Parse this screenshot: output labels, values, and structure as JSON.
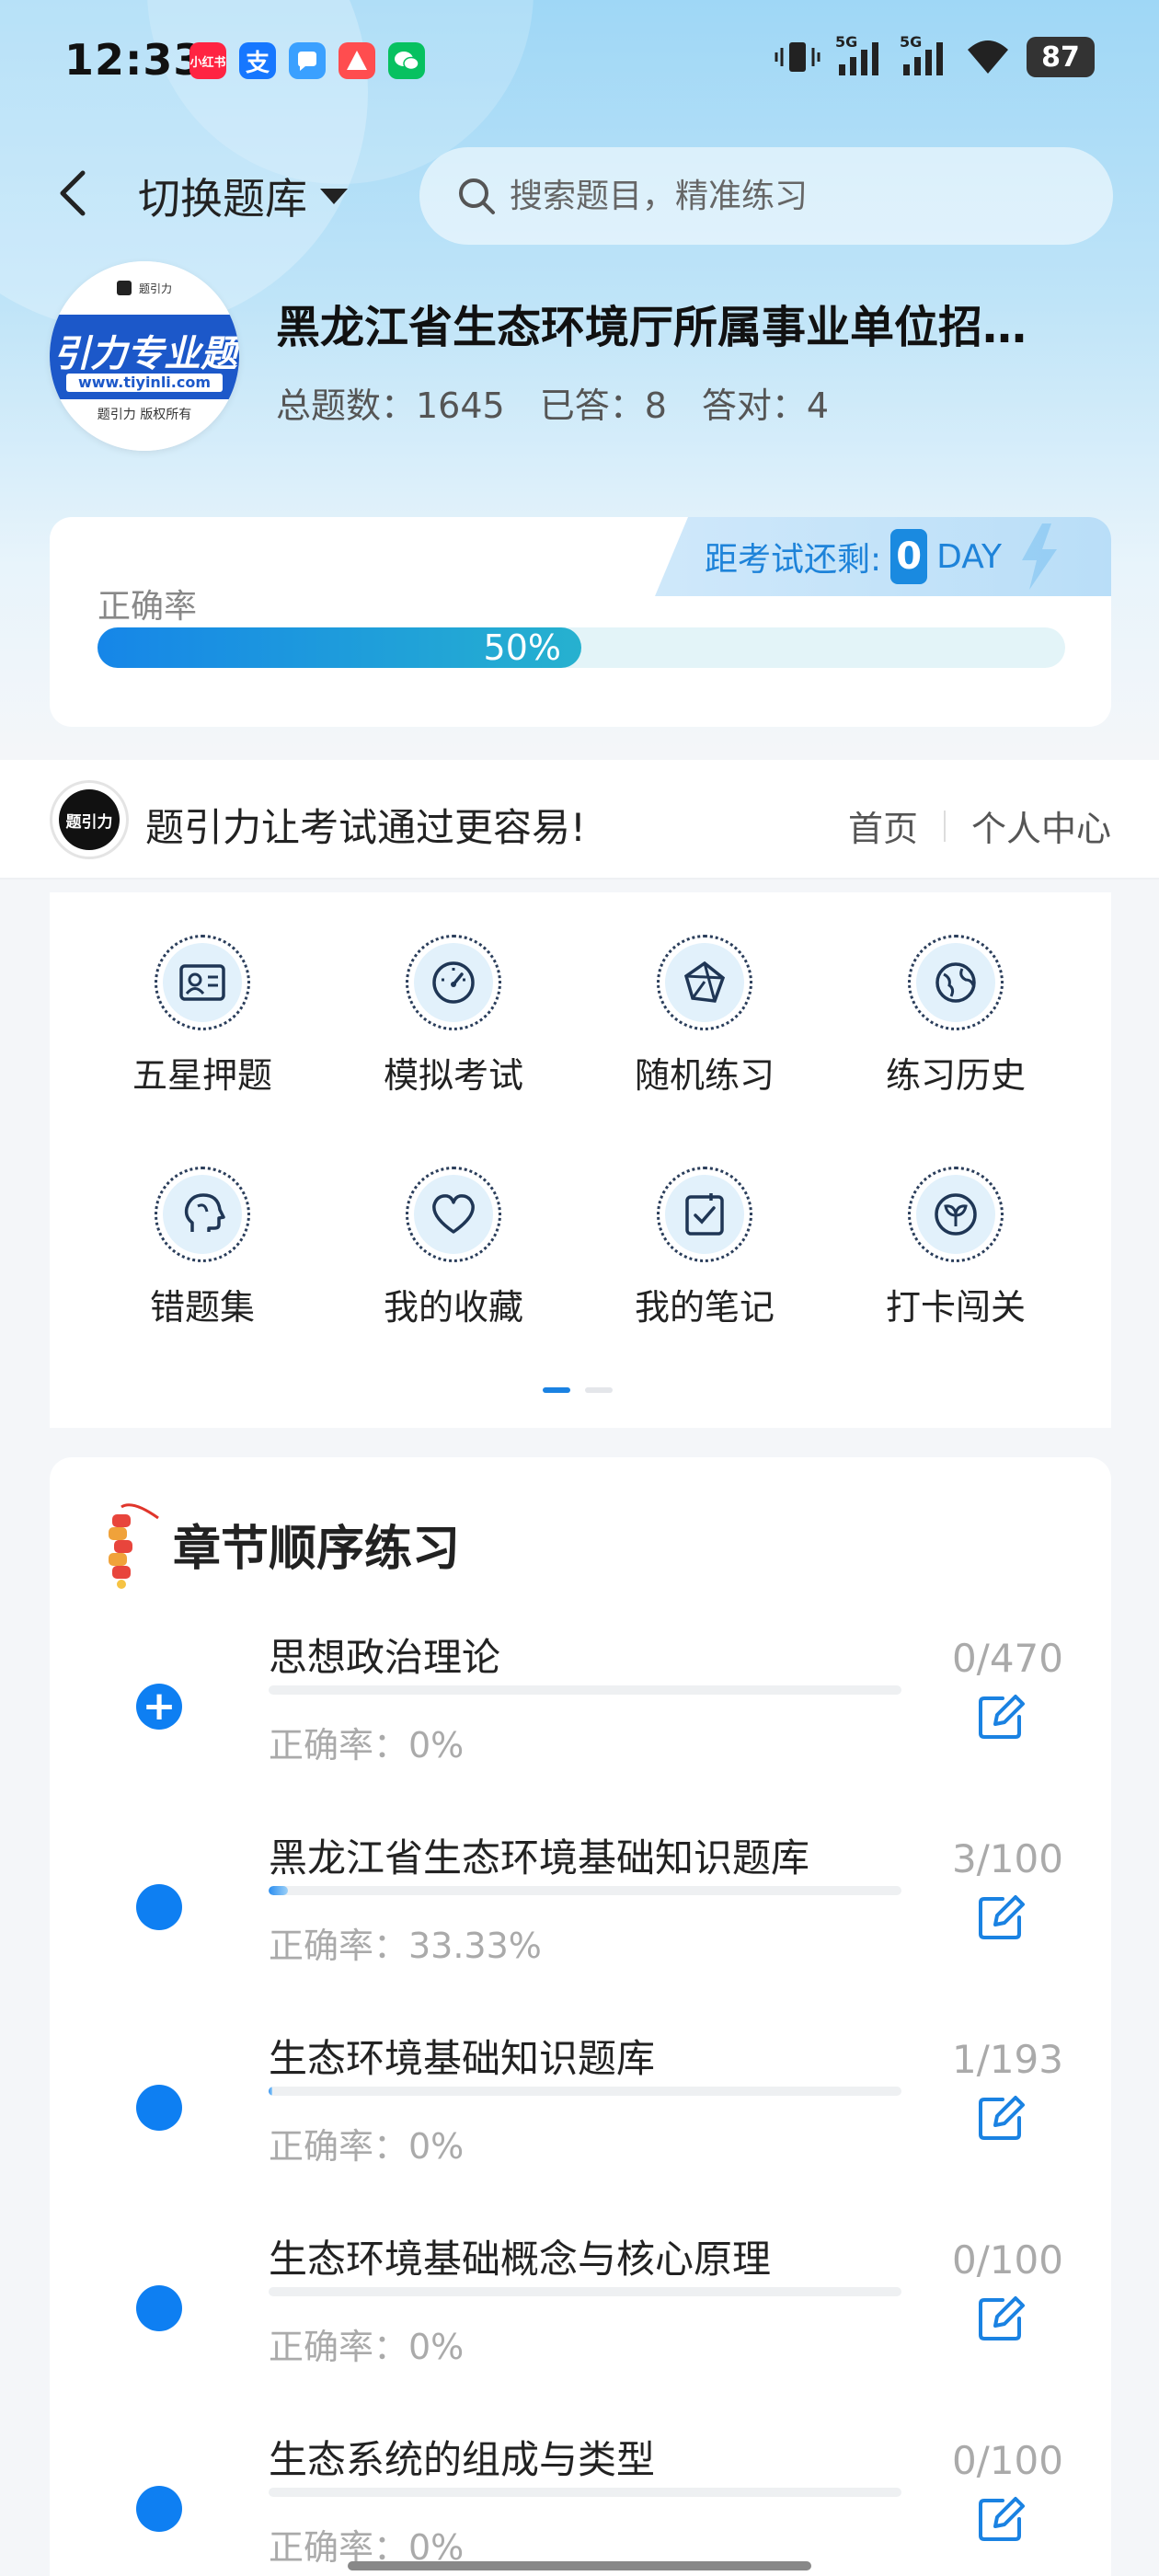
{
  "status_bar": {
    "time": "12:33",
    "app_icons": [
      {
        "name": "xiaohongshu-icon",
        "text": "小红书",
        "color": "#ff2442"
      },
      {
        "name": "alipay-icon",
        "text": "支",
        "color": "#1677ff"
      },
      {
        "name": "chat-app-icon",
        "text": "",
        "color": "#3aa0ff"
      },
      {
        "name": "travel-app-icon",
        "text": "",
        "color": "#ff4d4f"
      },
      {
        "name": "wechat-icon",
        "text": "",
        "color": "#07c160"
      }
    ],
    "network_1": "5G",
    "network_2": "5G",
    "battery": "87"
  },
  "nav": {
    "switch_label": "切换题库",
    "search_placeholder": "搜索题目，精准练习"
  },
  "bank": {
    "logo_brand": "引力专业题",
    "logo_top": "题引力",
    "logo_url": "www.tiyinli.com",
    "logo_bottom": "题引力 版权所有",
    "title": "黑龙江省生态环境厅所属事业单位招…",
    "stats": {
      "total_label": "总题数：1645",
      "answered_label": "已答：8",
      "correct_label": "答对：4"
    }
  },
  "accuracy": {
    "label": "正确率",
    "value_text": "50%",
    "value": 0.5,
    "countdown_label": "距考试还剩:",
    "countdown_days": "0",
    "countdown_unit": "DAY"
  },
  "promo": {
    "logo_text": "题引力",
    "slogan": "题引力让考试通过更容易!",
    "link_home": "首页",
    "link_profile": "个人中心"
  },
  "tools": [
    {
      "label": "五星押题",
      "icon": "id-card-icon"
    },
    {
      "label": "模拟考试",
      "icon": "gauge-icon"
    },
    {
      "label": "随机练习",
      "icon": "network-icon"
    },
    {
      "label": "练习历史",
      "icon": "globe-icon"
    },
    {
      "label": "错题集",
      "icon": "head-icon"
    },
    {
      "label": "我的收藏",
      "icon": "heart-icon"
    },
    {
      "label": "我的笔记",
      "icon": "note-check-icon"
    },
    {
      "label": "打卡闯关",
      "icon": "sprout-icon"
    }
  ],
  "chapters": {
    "title": "章节顺序练习",
    "items": [
      {
        "name": "思想政治理论",
        "accuracy": "正确率：0%",
        "count": "0/470",
        "progress": 0.0,
        "expandable": true
      },
      {
        "name": "黑龙江省生态环境基础知识题库",
        "accuracy": "正确率：33.33%",
        "count": "3/100",
        "progress": 0.03,
        "expandable": false
      },
      {
        "name": "生态环境基础知识题库",
        "accuracy": "正确率：0%",
        "count": "1/193",
        "progress": 0.005,
        "expandable": false
      },
      {
        "name": "生态环境基础概念与核心原理",
        "accuracy": "正确率：0%",
        "count": "0/100",
        "progress": 0.0,
        "expandable": false
      },
      {
        "name": "生态系统的组成与类型",
        "accuracy": "正确率：0%",
        "count": "0/100",
        "progress": 0.0,
        "expandable": false
      }
    ]
  },
  "colors": {
    "accent": "#0e7ff2",
    "countdown": "#1e83d9"
  }
}
